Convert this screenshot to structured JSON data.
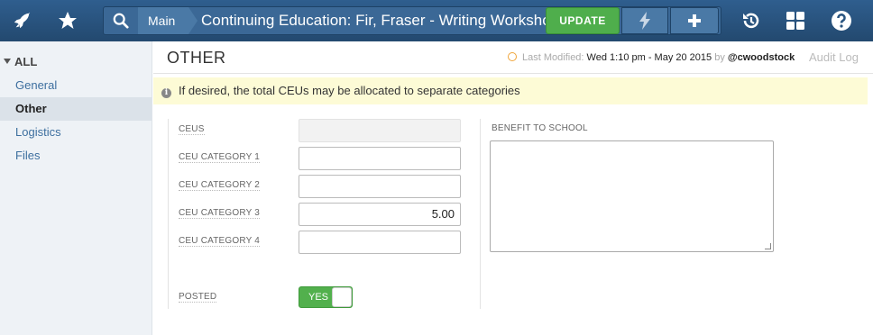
{
  "topbar": {
    "breadcrumb_main": "Main",
    "record_title": "Continuing Education: Fir, Fraser - Writing Workshop",
    "update_label": "UPDATE",
    "icons": [
      "rocket-icon",
      "star-icon",
      "search-icon",
      "lightning-icon",
      "plus-icon",
      "history-icon",
      "grid-icon",
      "help-icon"
    ]
  },
  "sidebar": {
    "all_label": "ALL",
    "items": [
      {
        "label": "General",
        "active": false
      },
      {
        "label": "Other",
        "active": true
      },
      {
        "label": "Logistics",
        "active": false
      },
      {
        "label": "Files",
        "active": false
      }
    ]
  },
  "header": {
    "section_title": "OTHER",
    "last_modified_label": "Last Modified:",
    "last_modified_value": "Wed 1:10 pm - May 20 2015",
    "by_label": "by",
    "modified_by": "@cwoodstock",
    "audit_log_label": "Audit Log"
  },
  "notice": {
    "text": "If desired, the total CEUs may be allocated to separate categories"
  },
  "form": {
    "ceus_label": "CEUS",
    "ceus_value": "",
    "cat1_label": "CEU CATEGORY 1",
    "cat1_value": "",
    "cat2_label": "CEU CATEGORY 2",
    "cat2_value": "",
    "cat3_label": "CEU CATEGORY 3",
    "cat3_value": "5.00",
    "cat4_label": "CEU CATEGORY 4",
    "cat4_value": "",
    "posted_label": "POSTED",
    "posted_value": "YES",
    "benefit_label": "BENEFIT TO SCHOOL",
    "benefit_value": ""
  },
  "colors": {
    "topbar": "#2a5580",
    "update_green": "#4fae4c",
    "link_blue": "#3d6f9f",
    "notice_bg": "#fdfbd6",
    "toggle_green": "#52b04d"
  }
}
